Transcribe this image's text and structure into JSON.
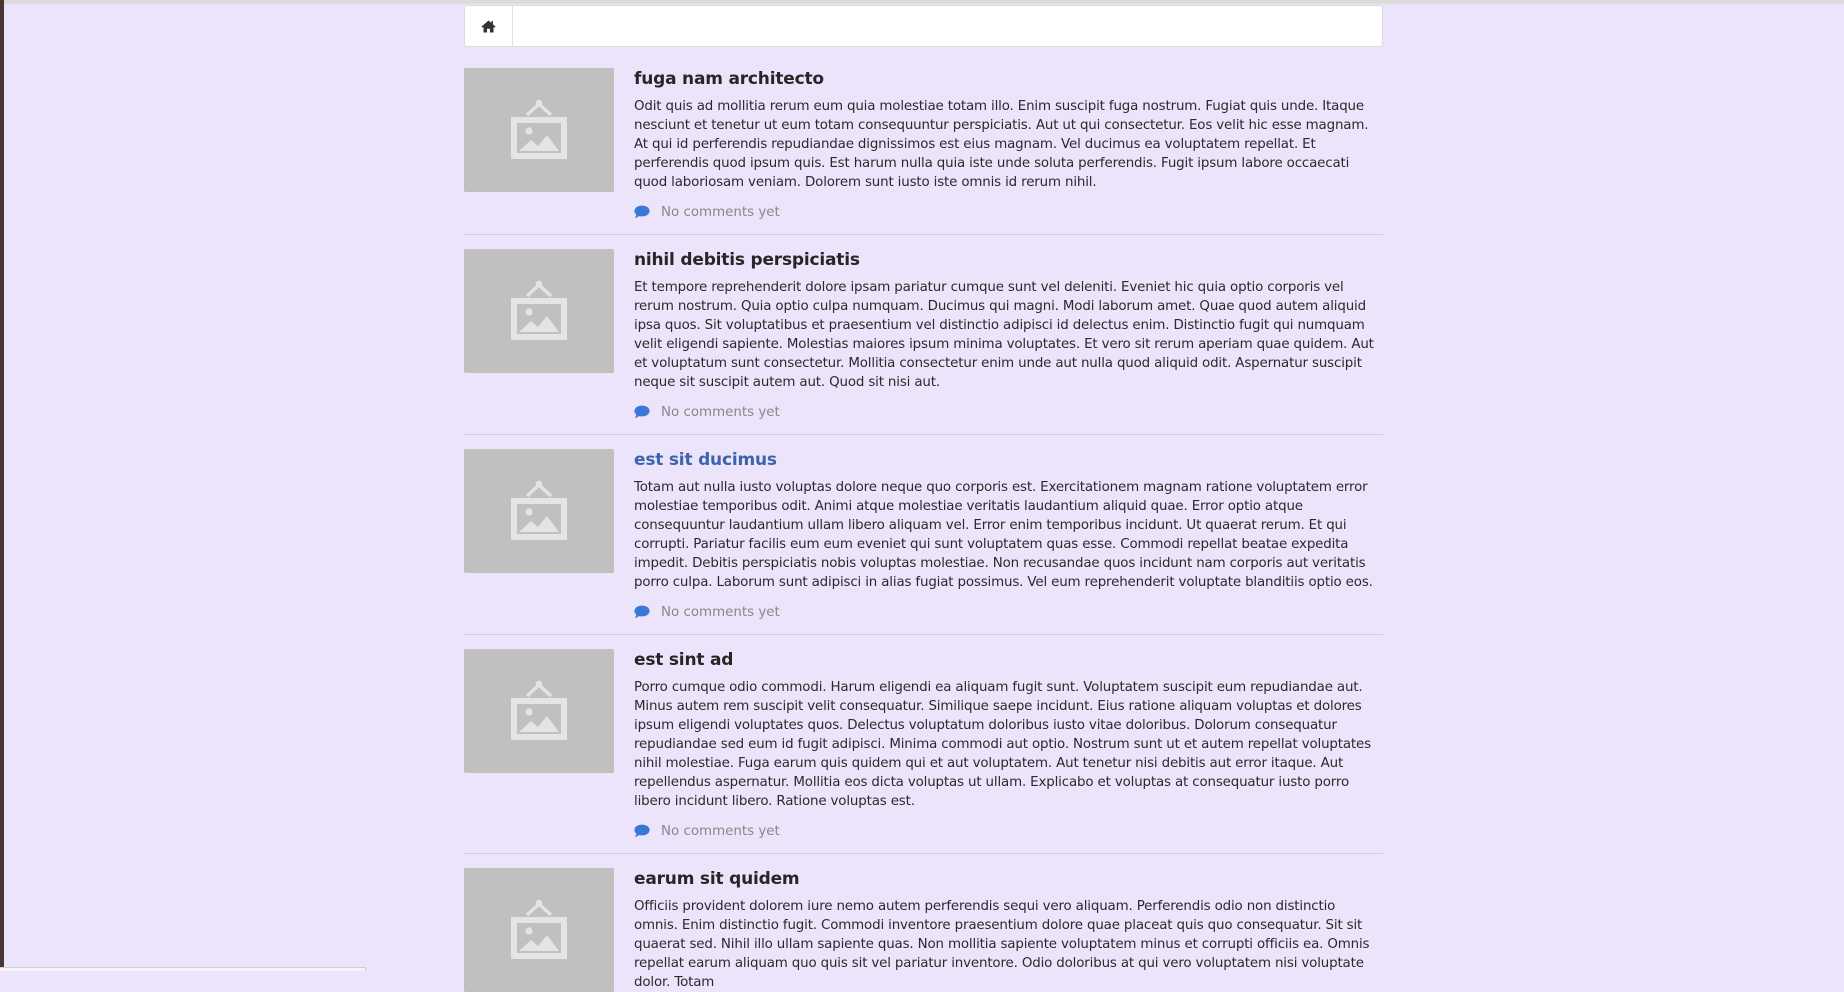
{
  "navbar": {
    "home_icon": "home-icon"
  },
  "colors": {
    "background": "#ece4fb",
    "link": "#3d63ad",
    "comment_icon": "#3a78d8",
    "placeholder": "#c0c0c0"
  },
  "posts": [
    {
      "title": "fuga nam architecto",
      "text": "Odit quis ad mollitia rerum eum quia molestiae totam illo. Enim suscipit fuga nostrum. Fugiat quis unde. Itaque nesciunt et tenetur ut eum totam consequuntur perspiciatis. Aut ut qui consectetur. Eos velit hic esse magnam. At qui id perferendis repudiandae dignissimos est eius magnam. Vel ducimus ea voluptatem repellat. Et perferendis quod ipsum quis. Est harum nulla quia iste unde soluta perferendis. Fugit ipsum labore occaecati quod laboriosam veniam. Dolorem sunt iusto iste omnis id rerum nihil.",
      "comments": "No comments yet"
    },
    {
      "title": "nihil debitis perspiciatis",
      "text": "Et tempore reprehenderit dolore ipsam pariatur cumque sunt vel deleniti. Eveniet hic quia optio corporis vel rerum nostrum. Quia optio culpa numquam. Ducimus qui magni. Modi laborum amet. Quae quod autem aliquid ipsa quos. Sit voluptatibus et praesentium vel distinctio adipisci id delectus enim. Distinctio fugit qui numquam velit eligendi sapiente. Molestias maiores ipsum minima voluptates. Et vero sit rerum aperiam quae quidem. Aut et voluptatum sunt consectetur. Mollitia consectetur enim unde aut nulla quod aliquid odit. Aspernatur suscipit neque sit suscipit autem aut. Quod sit nisi aut.",
      "comments": "No comments yet"
    },
    {
      "title": "est sit ducimus",
      "text": "Totam aut nulla iusto voluptas dolore neque quo corporis est. Exercitationem magnam ratione voluptatem error molestiae temporibus odit. Animi atque molestiae veritatis laudantium aliquid quae. Error optio atque consequuntur laudantium ullam libero aliquam vel. Error enim temporibus incidunt. Ut quaerat rerum. Et qui corrupti. Pariatur facilis eum eum eveniet qui sunt voluptatem quas esse. Commodi repellat beatae expedita impedit. Debitis perspiciatis nobis voluptas molestiae. Non recusandae quos incidunt nam corporis aut veritatis porro culpa. Laborum sunt adipisci in alias fugiat possimus. Vel eum reprehenderit voluptate blanditiis optio eos.",
      "comments": "No comments yet"
    },
    {
      "title": "est sint ad",
      "text": "Porro cumque odio commodi. Harum eligendi ea aliquam fugit sunt. Voluptatem suscipit eum repudiandae aut. Minus autem rem suscipit velit consequatur. Similique saepe incidunt. Eius ratione aliquam voluptas et dolores ipsum eligendi voluptates quos. Delectus voluptatum doloribus iusto vitae doloribus. Dolorum consequatur repudiandae sed eum id fugit adipisci. Minima commodi aut optio. Nostrum sunt ut et autem repellat voluptates nihil molestiae. Fuga earum quis quidem qui et aut voluptatem. Aut tenetur nisi debitis aut error itaque. Aut repellendus aspernatur. Mollitia eos dicta voluptas ut ullam. Explicabo et voluptas at consequatur iusto porro libero incidunt libero. Ratione voluptas est.",
      "comments": "No comments yet"
    },
    {
      "title": "earum sit quidem",
      "text": "Officiis provident dolorem iure nemo autem perferendis sequi vero aliquam. Perferendis odio non distinctio omnis. Enim distinctio fugit. Commodi inventore praesentium dolore quae placeat quis quo consequatur. Sit sit quaerat sed. Nihil illo ullam sapiente quas. Non mollitia sapiente voluptatem minus et corrupti officiis ea. Omnis repellat earum aliquam quo quis sit vel pariatur inventore. Odio doloribus at qui vero voluptatem nisi voluptate dolor. Totam"
    }
  ]
}
